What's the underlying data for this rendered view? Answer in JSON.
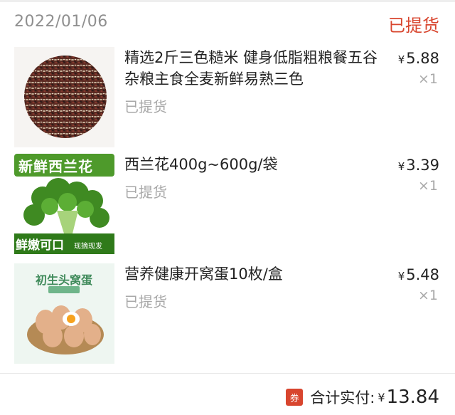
{
  "order": {
    "date": "2022/01/06",
    "status": "已提货"
  },
  "items": [
    {
      "title": "精选2斤三色糙米 健身低脂粗粮餐五谷杂粮主食全麦新鲜易熟三色",
      "status": "已提货",
      "currency": "¥",
      "price": "5.88",
      "qty": "×1",
      "image": "rice-product-photo"
    },
    {
      "title": "西兰花400g~600g/袋",
      "status": "已提货",
      "currency": "¥",
      "price": "3.39",
      "qty": "×1",
      "image": "broccoli-product-photo",
      "image_text": {
        "top": "新鲜西兰花",
        "bottom": "鲜嫩可口",
        "bottom_small": "现摘现发"
      }
    },
    {
      "title": "营养健康开窝蛋10枚/盒",
      "status": "已提货",
      "currency": "¥",
      "price": "5.48",
      "qty": "×1",
      "image": "eggs-product-photo",
      "image_text": {
        "top": "初生头窝蛋"
      }
    }
  ],
  "footer": {
    "coupon_badge": "券",
    "total_label": "合计实付:",
    "currency": "¥",
    "total_value": "13.84"
  },
  "colors": {
    "accent_red": "#d8452e",
    "muted_gray": "#a8a8a8",
    "broccoli_green": "#4e9a2b"
  }
}
